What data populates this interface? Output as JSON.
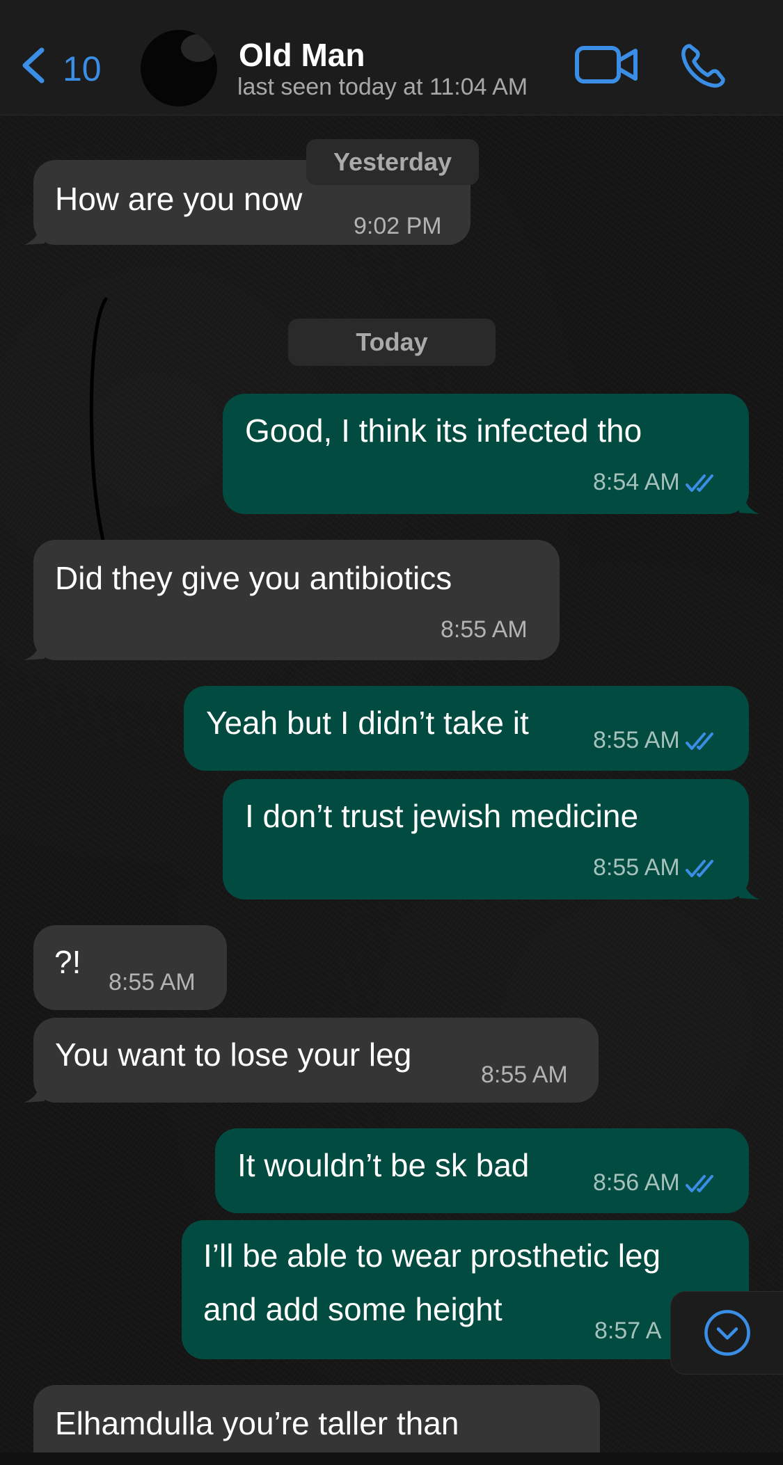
{
  "header": {
    "back_count": "10",
    "contact_name": "Old Man",
    "status": "last seen today at 11:04 AM",
    "icons": [
      "back-chevron-icon",
      "video-camera-icon",
      "phone-icon"
    ],
    "accent_color": "#3a8ee6"
  },
  "dates": {
    "yesterday": "Yesterday",
    "today": "Today"
  },
  "messages": [
    {
      "dir": "in",
      "text": "How are you now",
      "time": "9:02 PM"
    },
    {
      "dir": "out",
      "text": "Good, I think its infected tho",
      "time": "8:54 AM",
      "status": "read"
    },
    {
      "dir": "in",
      "text": "Did they give you antibiotics",
      "time": "8:55 AM"
    },
    {
      "dir": "out",
      "text": "Yeah but I didn’t take it",
      "time": "8:55 AM",
      "status": "read"
    },
    {
      "dir": "out",
      "text": "I don’t trust jewish medicine",
      "time": "8:55 AM",
      "status": "read"
    },
    {
      "dir": "in",
      "text": "?!",
      "time": "8:55 AM"
    },
    {
      "dir": "in",
      "text": "You want to lose your leg",
      "time": "8:55 AM"
    },
    {
      "dir": "out",
      "text": "It wouldn’t be sk bad",
      "time": "8:56 AM",
      "status": "read"
    },
    {
      "dir": "out",
      "text_line1": "I’ll be able to wear prosthetic leg",
      "text_line2": "and add some height",
      "time": "8:57 A",
      "status": "read"
    },
    {
      "dir": "in",
      "text": "Elhamdulla you’re taller than"
    }
  ],
  "colors": {
    "incoming_bubble": "#353535",
    "outgoing_bubble": "#024b40",
    "read_ticks": "#3a8ee6"
  }
}
